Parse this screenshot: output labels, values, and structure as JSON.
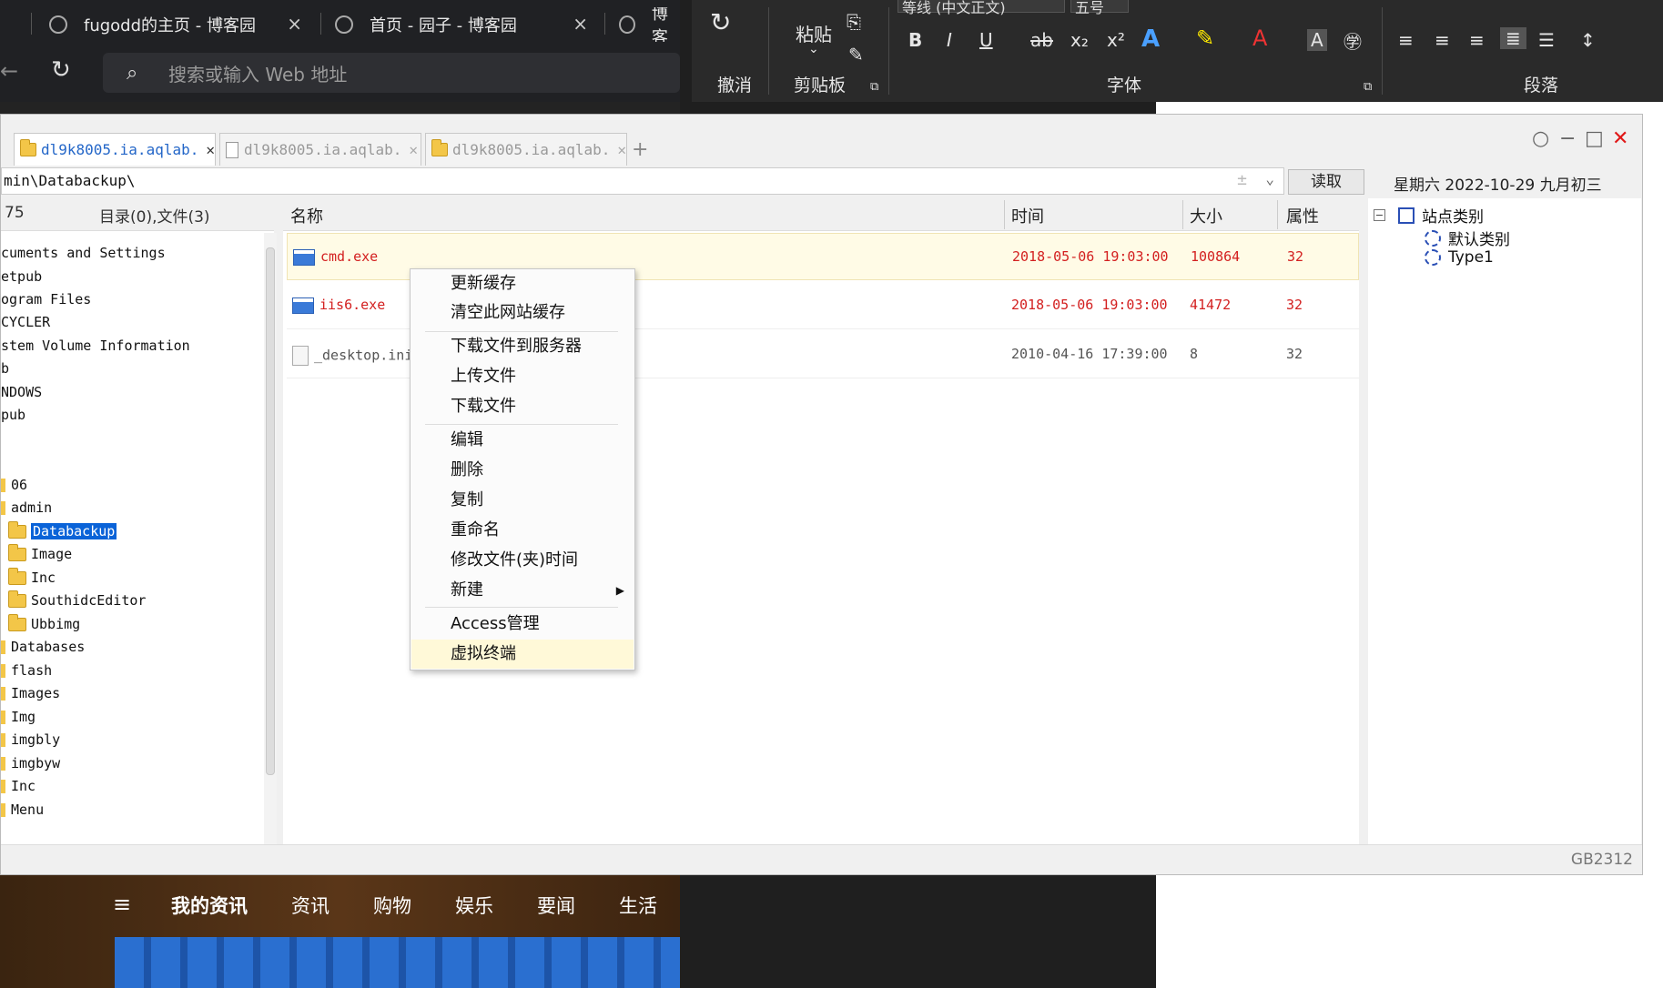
{
  "browser": {
    "tabs": [
      {
        "title": "fugodd的主页 - 博客园",
        "close": "×"
      },
      {
        "title": "首页 - 园子 - 博客园",
        "close": "×"
      },
      {
        "title": "博客"
      }
    ],
    "address_placeholder": "搜索或输入 Web 地址"
  },
  "ribbon": {
    "undo_label": "撤消",
    "paste_label": "粘贴",
    "clipboard_label": "剪贴板",
    "font_label": "字体",
    "paragraph_label": "段落",
    "font_name": "等线 (中文正文)",
    "font_size": "五号",
    "bold": "B",
    "italic": "I",
    "underline": "U",
    "strike": "ab",
    "subscript": "x₂",
    "superscript": "x²"
  },
  "filemanager": {
    "tabs": [
      {
        "label": "dl9k8005.ia.aqlab.",
        "close": "✕"
      },
      {
        "label": "dl9k8005.ia.aqlab.",
        "close": "✕"
      },
      {
        "label": "dl9k8005.ia.aqlab.",
        "close": "✕"
      }
    ],
    "add_tab": "+",
    "path": "min\\Databackup\\",
    "read_button": "读取",
    "date": "星期六 2022-10-29 九月初三",
    "left_header": {
      "col1": "75",
      "col2": "目录(0),文件(3)"
    },
    "columns": {
      "name": "名称",
      "time": "时间",
      "size": "大小",
      "attr": "属性"
    },
    "tree": [
      "cuments and Settings",
      "etpub",
      "ogram Files",
      "CYCLER",
      "stem Volume Information",
      "b",
      "NDOWS",
      "pub",
      "06",
      "admin",
      "Databackup",
      "Image",
      "Inc",
      "SouthidcEditor",
      "Ubbimg",
      "Databases",
      "flash",
      "Images",
      "Img",
      "imgbly",
      "imgbyw",
      "Inc",
      "Menu"
    ],
    "files": [
      {
        "name": "cmd.exe",
        "time": "2018-05-06 19:03:00",
        "size": "100864",
        "attr": "32"
      },
      {
        "name": "iis6.exe",
        "time": "2018-05-06 19:03:00",
        "size": "41472",
        "attr": "32"
      },
      {
        "name": "_desktop.ini",
        "time": "2010-04-16 17:39:00",
        "size": "8",
        "attr": "32"
      }
    ],
    "site_tree": {
      "root": "站点类别",
      "children": [
        "默认类别",
        "Type1"
      ]
    },
    "encoding": "GB2312"
  },
  "context_menu": {
    "items": [
      "更新缓存",
      "清空此网站缓存",
      "下载文件到服务器",
      "上传文件",
      "下载文件",
      "编辑",
      "删除",
      "复制",
      "重命名",
      "修改文件(夹)时间",
      "新建",
      "Access管理",
      "虚拟终端"
    ]
  },
  "news": {
    "nav": [
      "我的资讯",
      "资讯",
      "购物",
      "娱乐",
      "要闻",
      "生活"
    ]
  }
}
